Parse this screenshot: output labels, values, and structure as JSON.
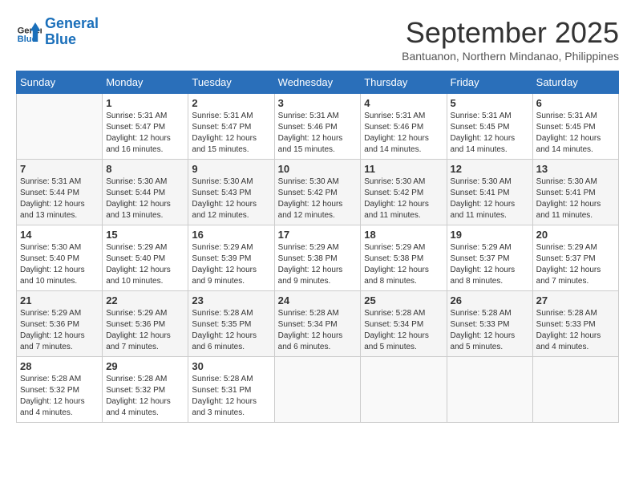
{
  "logo": {
    "line1": "General",
    "line2": "Blue"
  },
  "title": "September 2025",
  "subtitle": "Bantuanon, Northern Mindanao, Philippines",
  "days_of_week": [
    "Sunday",
    "Monday",
    "Tuesday",
    "Wednesday",
    "Thursday",
    "Friday",
    "Saturday"
  ],
  "weeks": [
    [
      {
        "day": "",
        "info": ""
      },
      {
        "day": "1",
        "info": "Sunrise: 5:31 AM\nSunset: 5:47 PM\nDaylight: 12 hours\nand 16 minutes."
      },
      {
        "day": "2",
        "info": "Sunrise: 5:31 AM\nSunset: 5:47 PM\nDaylight: 12 hours\nand 15 minutes."
      },
      {
        "day": "3",
        "info": "Sunrise: 5:31 AM\nSunset: 5:46 PM\nDaylight: 12 hours\nand 15 minutes."
      },
      {
        "day": "4",
        "info": "Sunrise: 5:31 AM\nSunset: 5:46 PM\nDaylight: 12 hours\nand 14 minutes."
      },
      {
        "day": "5",
        "info": "Sunrise: 5:31 AM\nSunset: 5:45 PM\nDaylight: 12 hours\nand 14 minutes."
      },
      {
        "day": "6",
        "info": "Sunrise: 5:31 AM\nSunset: 5:45 PM\nDaylight: 12 hours\nand 14 minutes."
      }
    ],
    [
      {
        "day": "7",
        "info": "Sunrise: 5:31 AM\nSunset: 5:44 PM\nDaylight: 12 hours\nand 13 minutes."
      },
      {
        "day": "8",
        "info": "Sunrise: 5:30 AM\nSunset: 5:44 PM\nDaylight: 12 hours\nand 13 minutes."
      },
      {
        "day": "9",
        "info": "Sunrise: 5:30 AM\nSunset: 5:43 PM\nDaylight: 12 hours\nand 12 minutes."
      },
      {
        "day": "10",
        "info": "Sunrise: 5:30 AM\nSunset: 5:42 PM\nDaylight: 12 hours\nand 12 minutes."
      },
      {
        "day": "11",
        "info": "Sunrise: 5:30 AM\nSunset: 5:42 PM\nDaylight: 12 hours\nand 11 minutes."
      },
      {
        "day": "12",
        "info": "Sunrise: 5:30 AM\nSunset: 5:41 PM\nDaylight: 12 hours\nand 11 minutes."
      },
      {
        "day": "13",
        "info": "Sunrise: 5:30 AM\nSunset: 5:41 PM\nDaylight: 12 hours\nand 11 minutes."
      }
    ],
    [
      {
        "day": "14",
        "info": "Sunrise: 5:30 AM\nSunset: 5:40 PM\nDaylight: 12 hours\nand 10 minutes."
      },
      {
        "day": "15",
        "info": "Sunrise: 5:29 AM\nSunset: 5:40 PM\nDaylight: 12 hours\nand 10 minutes."
      },
      {
        "day": "16",
        "info": "Sunrise: 5:29 AM\nSunset: 5:39 PM\nDaylight: 12 hours\nand 9 minutes."
      },
      {
        "day": "17",
        "info": "Sunrise: 5:29 AM\nSunset: 5:38 PM\nDaylight: 12 hours\nand 9 minutes."
      },
      {
        "day": "18",
        "info": "Sunrise: 5:29 AM\nSunset: 5:38 PM\nDaylight: 12 hours\nand 8 minutes."
      },
      {
        "day": "19",
        "info": "Sunrise: 5:29 AM\nSunset: 5:37 PM\nDaylight: 12 hours\nand 8 minutes."
      },
      {
        "day": "20",
        "info": "Sunrise: 5:29 AM\nSunset: 5:37 PM\nDaylight: 12 hours\nand 7 minutes."
      }
    ],
    [
      {
        "day": "21",
        "info": "Sunrise: 5:29 AM\nSunset: 5:36 PM\nDaylight: 12 hours\nand 7 minutes."
      },
      {
        "day": "22",
        "info": "Sunrise: 5:29 AM\nSunset: 5:36 PM\nDaylight: 12 hours\nand 7 minutes."
      },
      {
        "day": "23",
        "info": "Sunrise: 5:28 AM\nSunset: 5:35 PM\nDaylight: 12 hours\nand 6 minutes."
      },
      {
        "day": "24",
        "info": "Sunrise: 5:28 AM\nSunset: 5:34 PM\nDaylight: 12 hours\nand 6 minutes."
      },
      {
        "day": "25",
        "info": "Sunrise: 5:28 AM\nSunset: 5:34 PM\nDaylight: 12 hours\nand 5 minutes."
      },
      {
        "day": "26",
        "info": "Sunrise: 5:28 AM\nSunset: 5:33 PM\nDaylight: 12 hours\nand 5 minutes."
      },
      {
        "day": "27",
        "info": "Sunrise: 5:28 AM\nSunset: 5:33 PM\nDaylight: 12 hours\nand 4 minutes."
      }
    ],
    [
      {
        "day": "28",
        "info": "Sunrise: 5:28 AM\nSunset: 5:32 PM\nDaylight: 12 hours\nand 4 minutes."
      },
      {
        "day": "29",
        "info": "Sunrise: 5:28 AM\nSunset: 5:32 PM\nDaylight: 12 hours\nand 4 minutes."
      },
      {
        "day": "30",
        "info": "Sunrise: 5:28 AM\nSunset: 5:31 PM\nDaylight: 12 hours\nand 3 minutes."
      },
      {
        "day": "",
        "info": ""
      },
      {
        "day": "",
        "info": ""
      },
      {
        "day": "",
        "info": ""
      },
      {
        "day": "",
        "info": ""
      }
    ]
  ]
}
